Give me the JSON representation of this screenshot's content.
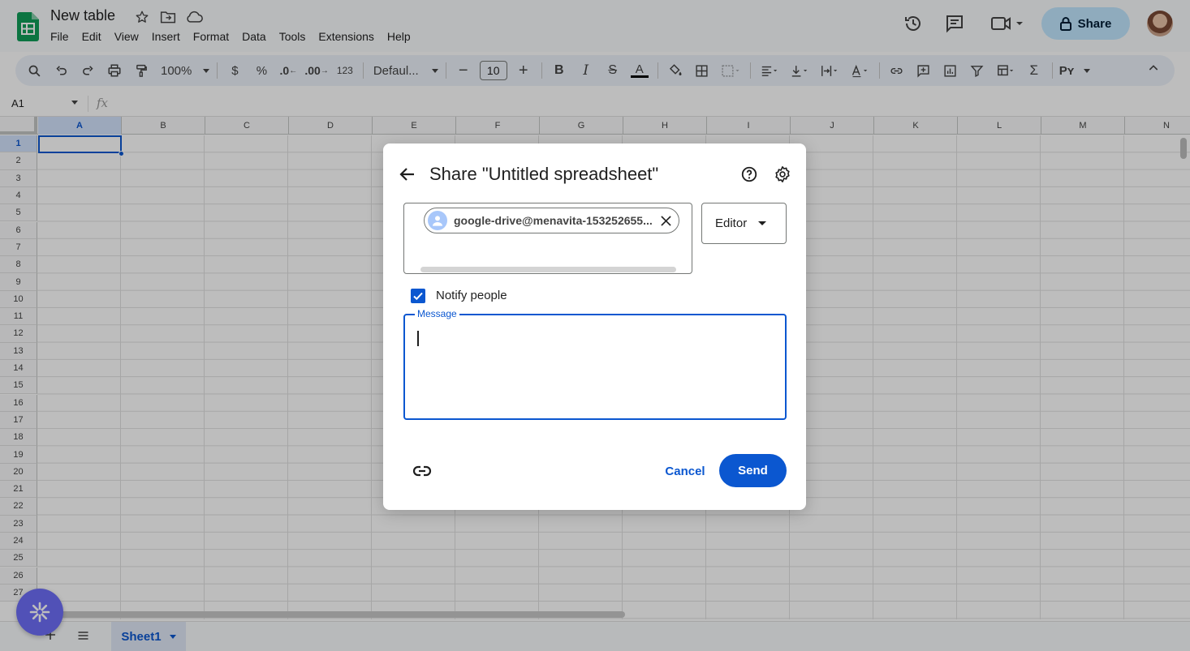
{
  "header": {
    "doc_title": "New table",
    "menu": [
      "File",
      "Edit",
      "View",
      "Insert",
      "Format",
      "Data",
      "Tools",
      "Extensions",
      "Help"
    ],
    "share_label": "Share"
  },
  "toolbar": {
    "zoom": "100%",
    "currency": "$",
    "percent": "%",
    "decrease_decimal": ".0",
    "increase_decimal": ".00",
    "number_format": "123",
    "font_family": "Defaul...",
    "font_size": "10"
  },
  "formula_bar": {
    "name_box": "A1",
    "fx": "fx"
  },
  "grid": {
    "columns": [
      "A",
      "B",
      "C",
      "D",
      "E",
      "F",
      "G",
      "H",
      "I",
      "J",
      "K",
      "L",
      "M",
      "N"
    ],
    "rows": [
      "1",
      "2",
      "3",
      "4",
      "5",
      "6",
      "7",
      "8",
      "9",
      "10",
      "11",
      "12",
      "13",
      "14",
      "15",
      "16",
      "17",
      "18",
      "19",
      "20",
      "21",
      "22",
      "23",
      "24",
      "25",
      "26",
      "27"
    ],
    "selected_cell": "A1"
  },
  "sheets": {
    "active": "Sheet1"
  },
  "dialog": {
    "title": "Share \"Untitled spreadsheet\"",
    "recipient": "google-drive@menavita-153252655...",
    "role": "Editor",
    "notify_label": "Notify people",
    "notify_checked": true,
    "message_label": "Message",
    "message_value": "",
    "cancel_label": "Cancel",
    "send_label": "Send"
  },
  "colors": {
    "accent": "#0b57d0",
    "share_button_bg": "#c2e7ff",
    "fab_bg": "#6e6ef7",
    "sheets_green": "#0f9d58"
  }
}
